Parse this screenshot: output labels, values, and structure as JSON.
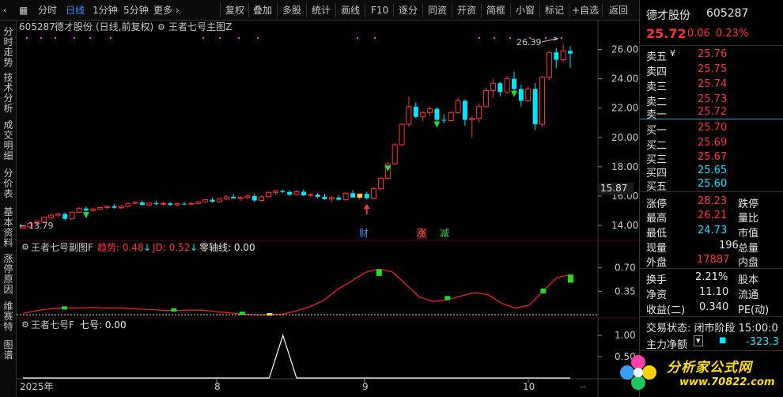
{
  "toolbar": {
    "time_share": "分时",
    "daily": "日线",
    "one_min": "1分钟",
    "five_min": "5分钟",
    "more": "更多 ›",
    "items": [
      "复权",
      "叠加",
      "多股",
      "统计",
      "画线",
      "F10",
      "逐分",
      "同资",
      "开资",
      "简框",
      "小窗",
      "标记",
      "+自选",
      "返回"
    ]
  },
  "sidebar": {
    "tabs": [
      "分时走势",
      "技术分析",
      "成交明细",
      "分价表",
      "基本资料",
      "涨停原因",
      "维赛特",
      "图谱"
    ]
  },
  "main_panel": {
    "code": "605287",
    "name": "德才股份",
    "period": "(日线,前复权)",
    "indicator": "王者七号主图Z",
    "max_label": "26.39",
    "min_label": "13.79",
    "current_price_tag": "15.87",
    "signal_markers": [
      "财",
      "涨",
      "减"
    ]
  },
  "sub_panel1": {
    "name": "王者七号副图F",
    "trend_label": "趋势: 0.48",
    "jd_label": "JD: 0.52",
    "zero_label": "零轴线: 0.00"
  },
  "sub_panel2": {
    "name": "王者七号F",
    "value_label": "七号: 0.00"
  },
  "x_axis": {
    "labels": [
      "2025年",
      "8",
      "9",
      "10"
    ]
  },
  "quote": {
    "name": "德才股份",
    "code": "605287",
    "price": "25.72",
    "change": "0.06",
    "pct": "0.23%",
    "asks": [
      {
        "label": "卖五",
        "price": "25.76"
      },
      {
        "label": "卖四",
        "price": "25.75"
      },
      {
        "label": "卖三",
        "price": "25.74"
      },
      {
        "label": "卖二",
        "price": "25.73"
      },
      {
        "label": "卖一",
        "price": "25.72"
      }
    ],
    "bids": [
      {
        "label": "买一",
        "price": "25.70"
      },
      {
        "label": "买二",
        "price": "25.69"
      },
      {
        "label": "买三",
        "price": "25.67"
      },
      {
        "label": "买四",
        "price": "25.65"
      },
      {
        "label": "买五",
        "price": "25.60"
      }
    ],
    "stats": [
      {
        "label": "涨停",
        "value": "28.23",
        "label2": "跌停"
      },
      {
        "label": "最高",
        "value": "26.21",
        "label2": "量比"
      },
      {
        "label": "最低",
        "value": "24.73",
        "label2": "市值"
      },
      {
        "label": "现量",
        "value": "196",
        "label2": "总量"
      },
      {
        "label": "外盘",
        "value": "17887",
        "label2": "内盘"
      }
    ],
    "stats2": [
      {
        "label": "换手",
        "value": "2.21%",
        "label2": "股本"
      },
      {
        "label": "净资",
        "value": "11.10",
        "label2": "流通"
      },
      {
        "label": "收益(二)",
        "value": "0.340",
        "label2": "PE(动)"
      }
    ],
    "trade_status": "交易状态: 闭市阶段 15:00:0",
    "main_flow_label": "主力净额",
    "main_flow_value": "-323.3",
    "watermark": "分析家公式网",
    "watermark_url": "www.70822.com"
  },
  "chart_data": [
    {
      "type": "candlestick",
      "title": "605287 德才股份 (日线,前复权)",
      "y_ticks": [
        14.0,
        16.0,
        18.0,
        20.0,
        22.0,
        24.0,
        26.0
      ],
      "ylim": [
        13.3,
        27.0
      ],
      "x_labels": [
        "2025年",
        "8",
        "9",
        "10"
      ],
      "ohlc": [
        [
          13.79,
          13.95,
          13.79,
          13.9
        ],
        [
          13.9,
          14.2,
          13.85,
          14.15
        ],
        [
          14.15,
          14.35,
          14.05,
          14.28
        ],
        [
          14.28,
          14.6,
          14.2,
          14.55
        ],
        [
          14.55,
          14.75,
          14.4,
          14.7
        ],
        [
          14.7,
          14.85,
          14.55,
          14.78
        ],
        [
          14.78,
          14.9,
          14.35,
          14.45
        ],
        [
          14.45,
          14.95,
          14.4,
          14.9
        ],
        [
          14.9,
          15.25,
          14.85,
          15.15
        ],
        [
          15.15,
          15.3,
          14.95,
          15.02
        ],
        [
          15.02,
          15.2,
          14.95,
          15.12
        ],
        [
          15.12,
          15.3,
          15.05,
          15.22
        ],
        [
          15.22,
          15.35,
          15.1,
          15.3
        ],
        [
          15.3,
          15.45,
          15.15,
          15.2
        ],
        [
          15.2,
          15.4,
          15.1,
          15.3
        ],
        [
          15.3,
          15.55,
          15.25,
          15.5
        ],
        [
          15.5,
          15.65,
          15.45,
          15.58
        ],
        [
          15.58,
          15.7,
          15.35,
          15.4
        ],
        [
          15.4,
          15.6,
          15.3,
          15.52
        ],
        [
          15.52,
          15.7,
          15.4,
          15.45
        ],
        [
          15.45,
          15.6,
          15.35,
          15.5
        ],
        [
          15.5,
          15.6,
          15.35,
          15.4
        ],
        [
          15.4,
          15.55,
          15.3,
          15.48
        ],
        [
          15.48,
          15.6,
          15.4,
          15.45
        ],
        [
          15.45,
          15.58,
          15.38,
          15.5
        ],
        [
          15.5,
          15.65,
          15.42,
          15.6
        ],
        [
          15.6,
          15.8,
          15.55,
          15.75
        ],
        [
          15.75,
          15.9,
          15.55,
          15.62
        ],
        [
          15.62,
          15.85,
          15.55,
          15.8
        ],
        [
          15.8,
          16.05,
          15.7,
          15.95
        ],
        [
          15.95,
          16.15,
          15.85,
          15.85
        ],
        [
          15.85,
          16.0,
          15.65,
          15.9
        ],
        [
          15.9,
          16.1,
          15.8,
          16.0
        ],
        [
          16.0,
          16.2,
          15.6,
          15.7
        ],
        [
          15.7,
          16.05,
          15.6,
          15.95
        ],
        [
          15.95,
          16.3,
          15.9,
          16.25
        ],
        [
          16.25,
          16.4,
          16.1,
          16.35
        ],
        [
          16.35,
          16.45,
          16.2,
          16.28
        ],
        [
          16.28,
          16.4,
          16.0,
          16.1
        ],
        [
          16.1,
          16.4,
          16.05,
          16.3
        ],
        [
          16.3,
          16.45,
          16.0,
          16.05
        ],
        [
          16.05,
          16.2,
          15.9,
          16.1
        ],
        [
          16.1,
          16.2,
          15.85,
          15.95
        ],
        [
          15.95,
          16.15,
          15.75,
          15.8
        ],
        [
          15.8,
          16.0,
          15.6,
          15.9
        ],
        [
          15.9,
          16.05,
          15.7,
          15.75
        ],
        [
          15.75,
          16.25,
          15.7,
          16.2
        ],
        [
          16.2,
          16.4,
          16.1,
          15.9
        ],
        [
          15.9,
          16.2,
          15.75,
          16.15
        ],
        [
          16.15,
          16.3,
          15.8,
          15.85
        ],
        [
          15.85,
          16.6,
          15.8,
          16.5
        ],
        [
          16.5,
          17.3,
          16.4,
          17.2
        ],
        [
          17.2,
          18.3,
          17.1,
          18.2
        ],
        [
          18.2,
          19.6,
          18.1,
          19.5
        ],
        [
          19.5,
          21.0,
          19.4,
          20.9
        ],
        [
          20.9,
          22.8,
          20.7,
          22.1
        ],
        [
          22.1,
          22.4,
          21.3,
          21.4
        ],
        [
          21.4,
          21.8,
          21.1,
          21.7
        ],
        [
          21.7,
          22.1,
          21.5,
          21.95
        ],
        [
          21.95,
          22.05,
          20.85,
          21.2
        ],
        [
          21.2,
          21.6,
          20.95,
          21.15
        ],
        [
          21.15,
          21.8,
          21.1,
          21.7
        ],
        [
          21.7,
          22.7,
          21.6,
          22.5
        ],
        [
          22.5,
          22.6,
          20.8,
          21.2
        ],
        [
          21.2,
          21.45,
          20.0,
          21.3
        ],
        [
          21.3,
          22.3,
          21.0,
          22.1
        ],
        [
          22.1,
          23.4,
          22.0,
          23.2
        ],
        [
          23.2,
          24.0,
          22.7,
          23.7
        ],
        [
          23.7,
          23.8,
          22.8,
          23.1
        ],
        [
          23.1,
          24.2,
          23.0,
          24.0
        ],
        [
          24.0,
          24.5,
          23.1,
          23.3
        ],
        [
          23.3,
          23.6,
          22.1,
          22.5
        ],
        [
          22.5,
          23.5,
          22.4,
          23.3
        ],
        [
          23.3,
          23.7,
          20.5,
          20.9
        ],
        [
          20.9,
          24.2,
          20.7,
          24.1
        ],
        [
          24.1,
          25.9,
          23.9,
          25.8
        ],
        [
          25.8,
          26.1,
          24.7,
          25.3
        ],
        [
          25.3,
          26.39,
          25.1,
          25.9
        ],
        [
          25.9,
          26.21,
          24.73,
          25.72
        ]
      ]
    },
    {
      "type": "line",
      "name": "王者七号副图F",
      "series": [
        {
          "name": "趋势",
          "last": 0.48
        },
        {
          "name": "JD",
          "last": 0.52
        },
        {
          "name": "零轴线",
          "last": 0.0
        }
      ],
      "y_ticks": [
        0.35,
        0.7
      ],
      "ylim": [
        0,
        0.85
      ],
      "trend_values": [
        0.02,
        0.06,
        0.09,
        0.1,
        0.1,
        0.11,
        0.1,
        0.1,
        0.09,
        0.08,
        0.07,
        0.06,
        0.07,
        0.07,
        0.05,
        0.03,
        0.01,
        0.0,
        0.0,
        0.01,
        0.06,
        0.12,
        0.22,
        0.38,
        0.5,
        0.63,
        0.68,
        0.64,
        0.45,
        0.26,
        0.2,
        0.22,
        0.28,
        0.33,
        0.3,
        0.17,
        0.1,
        0.14,
        0.35,
        0.55,
        0.6
      ]
    },
    {
      "type": "line",
      "name": "王者七号F",
      "series": [
        {
          "name": "七号",
          "last": 0.0
        }
      ],
      "y_ticks": [
        0.5,
        1.0
      ],
      "ylim": [
        0,
        1.15
      ],
      "spike_values": [
        0,
        0,
        0,
        0,
        0,
        0,
        0,
        0,
        0,
        0,
        0,
        0,
        0,
        0,
        0,
        0,
        0,
        0,
        0,
        1,
        0,
        0,
        0,
        0,
        0,
        0,
        0,
        0,
        0,
        0,
        0,
        0,
        0,
        0,
        0,
        0,
        0,
        0,
        0,
        0,
        0
      ]
    }
  ]
}
